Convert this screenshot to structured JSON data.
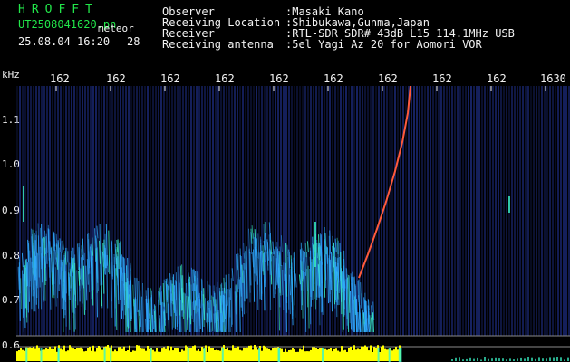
{
  "header": {
    "title": "HROFFT",
    "filename": "UT2508041620.pn",
    "file_tag": "meteor",
    "timestamp": "25.08.04 16:20",
    "count": "28"
  },
  "info": {
    "observer_label": "Observer",
    "observer_value": ":Masaki Kano",
    "location_label": "Receiving Location",
    "location_value": ":Shibukawa,Gunma,Japan",
    "receiver_label": "Receiver",
    "receiver_value": ":RTL-SDR SDR# 43dB L15 114.1MHz USB",
    "antenna_label": "Receiving antenna",
    "antenna_value": ":5el Yagi Az 20 for Aomori VOR"
  },
  "axis": {
    "y_unit": "kHz",
    "y_ticks": [
      "1.1",
      "1.0",
      "0.9",
      "0.8",
      "0.7",
      "0.6"
    ],
    "x_ticks": [
      "162",
      "162",
      "162",
      "162",
      "162",
      "162",
      "162",
      "162",
      "162",
      "1630"
    ]
  },
  "colors": {
    "background": "#000000",
    "title": "#22e64a",
    "text": "#f2f2f2",
    "noise": "#1b2a7a",
    "echo": "#2fa8ff",
    "echo_hot": "#3af5c8",
    "trail": "#ff5a3c",
    "power_bar": "#ffff00"
  }
}
